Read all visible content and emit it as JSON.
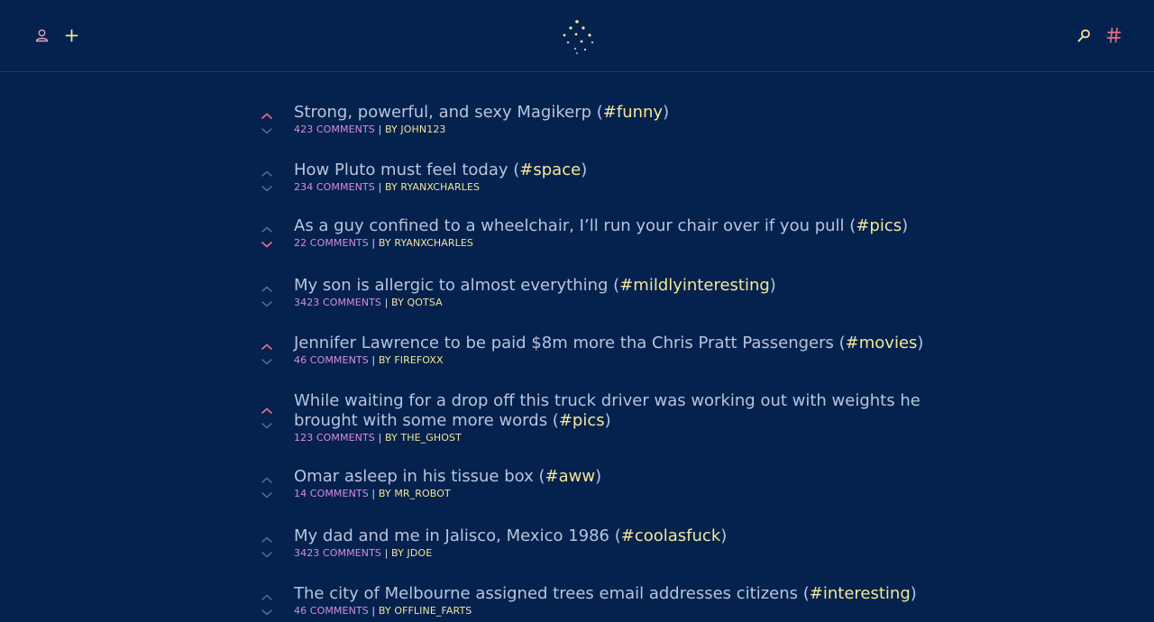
{
  "colors": {
    "background": "#04224d",
    "title": "#b9c4dd",
    "tag": "#f3e79a",
    "comments": "#d98ae0",
    "author": "#f0e49a",
    "vote_active": "#e26d87",
    "vote_inactive": "#5e6f96",
    "header_icon_pink": "#e6a3b6",
    "header_icon_yellow": "#f3e79a"
  },
  "header": {
    "icons": [
      "user-icon",
      "plus-icon",
      "logo-dots",
      "search-icon",
      "hash-icon"
    ]
  },
  "posts": [
    {
      "title": "Strong, powerful, and sexy Magikerp",
      "tag": "#funny",
      "comments": "423 COMMENTS",
      "author": "JOHN123",
      "vote": "up"
    },
    {
      "title": "How Pluto must feel today",
      "tag": "#space",
      "comments": "234 COMMENTS",
      "author": "RYANXCHARLES",
      "vote": "none"
    },
    {
      "title": "As a guy confined to a wheelchair, I’ll run your chair over if you pull",
      "tag": "#pics",
      "comments": "22 COMMENTS",
      "author": "RYANXCHARLES",
      "vote": "down"
    },
    {
      "title": "My son is allergic to almost everything",
      "tag": "#mildlyinteresting",
      "comments": "3423 COMMENTS",
      "author": "QOTSA",
      "vote": "none"
    },
    {
      "title": "Jennifer Lawrence to be paid $8m more tha Chris Pratt Passengers",
      "tag": "#movies",
      "comments": "46 COMMENTS",
      "author": "FIREFOXX",
      "vote": "up"
    },
    {
      "title": "While waiting for a drop off this truck driver was working out with weights he brought with some more words",
      "tag": "#pics",
      "comments": "123 COMMENTS",
      "author": "THE_GHOST",
      "vote": "up"
    },
    {
      "title": "Omar asleep in his tissue box",
      "tag": "#aww",
      "comments": "14 COMMENTS",
      "author": "MR_ROBOT",
      "vote": "none"
    },
    {
      "title": "My dad and me in Jalisco, Mexico 1986",
      "tag": "#coolasfuck",
      "comments": "3423 COMMENTS",
      "author": "JDOE",
      "vote": "none"
    },
    {
      "title": "The city of Melbourne assigned trees email addresses citizens",
      "tag": "#interesting",
      "comments": "46 COMMENTS",
      "author": "OFFLINE_FARTS",
      "vote": "none"
    }
  ],
  "meta_text": {
    "separator": "|",
    "by_label": "BY"
  }
}
